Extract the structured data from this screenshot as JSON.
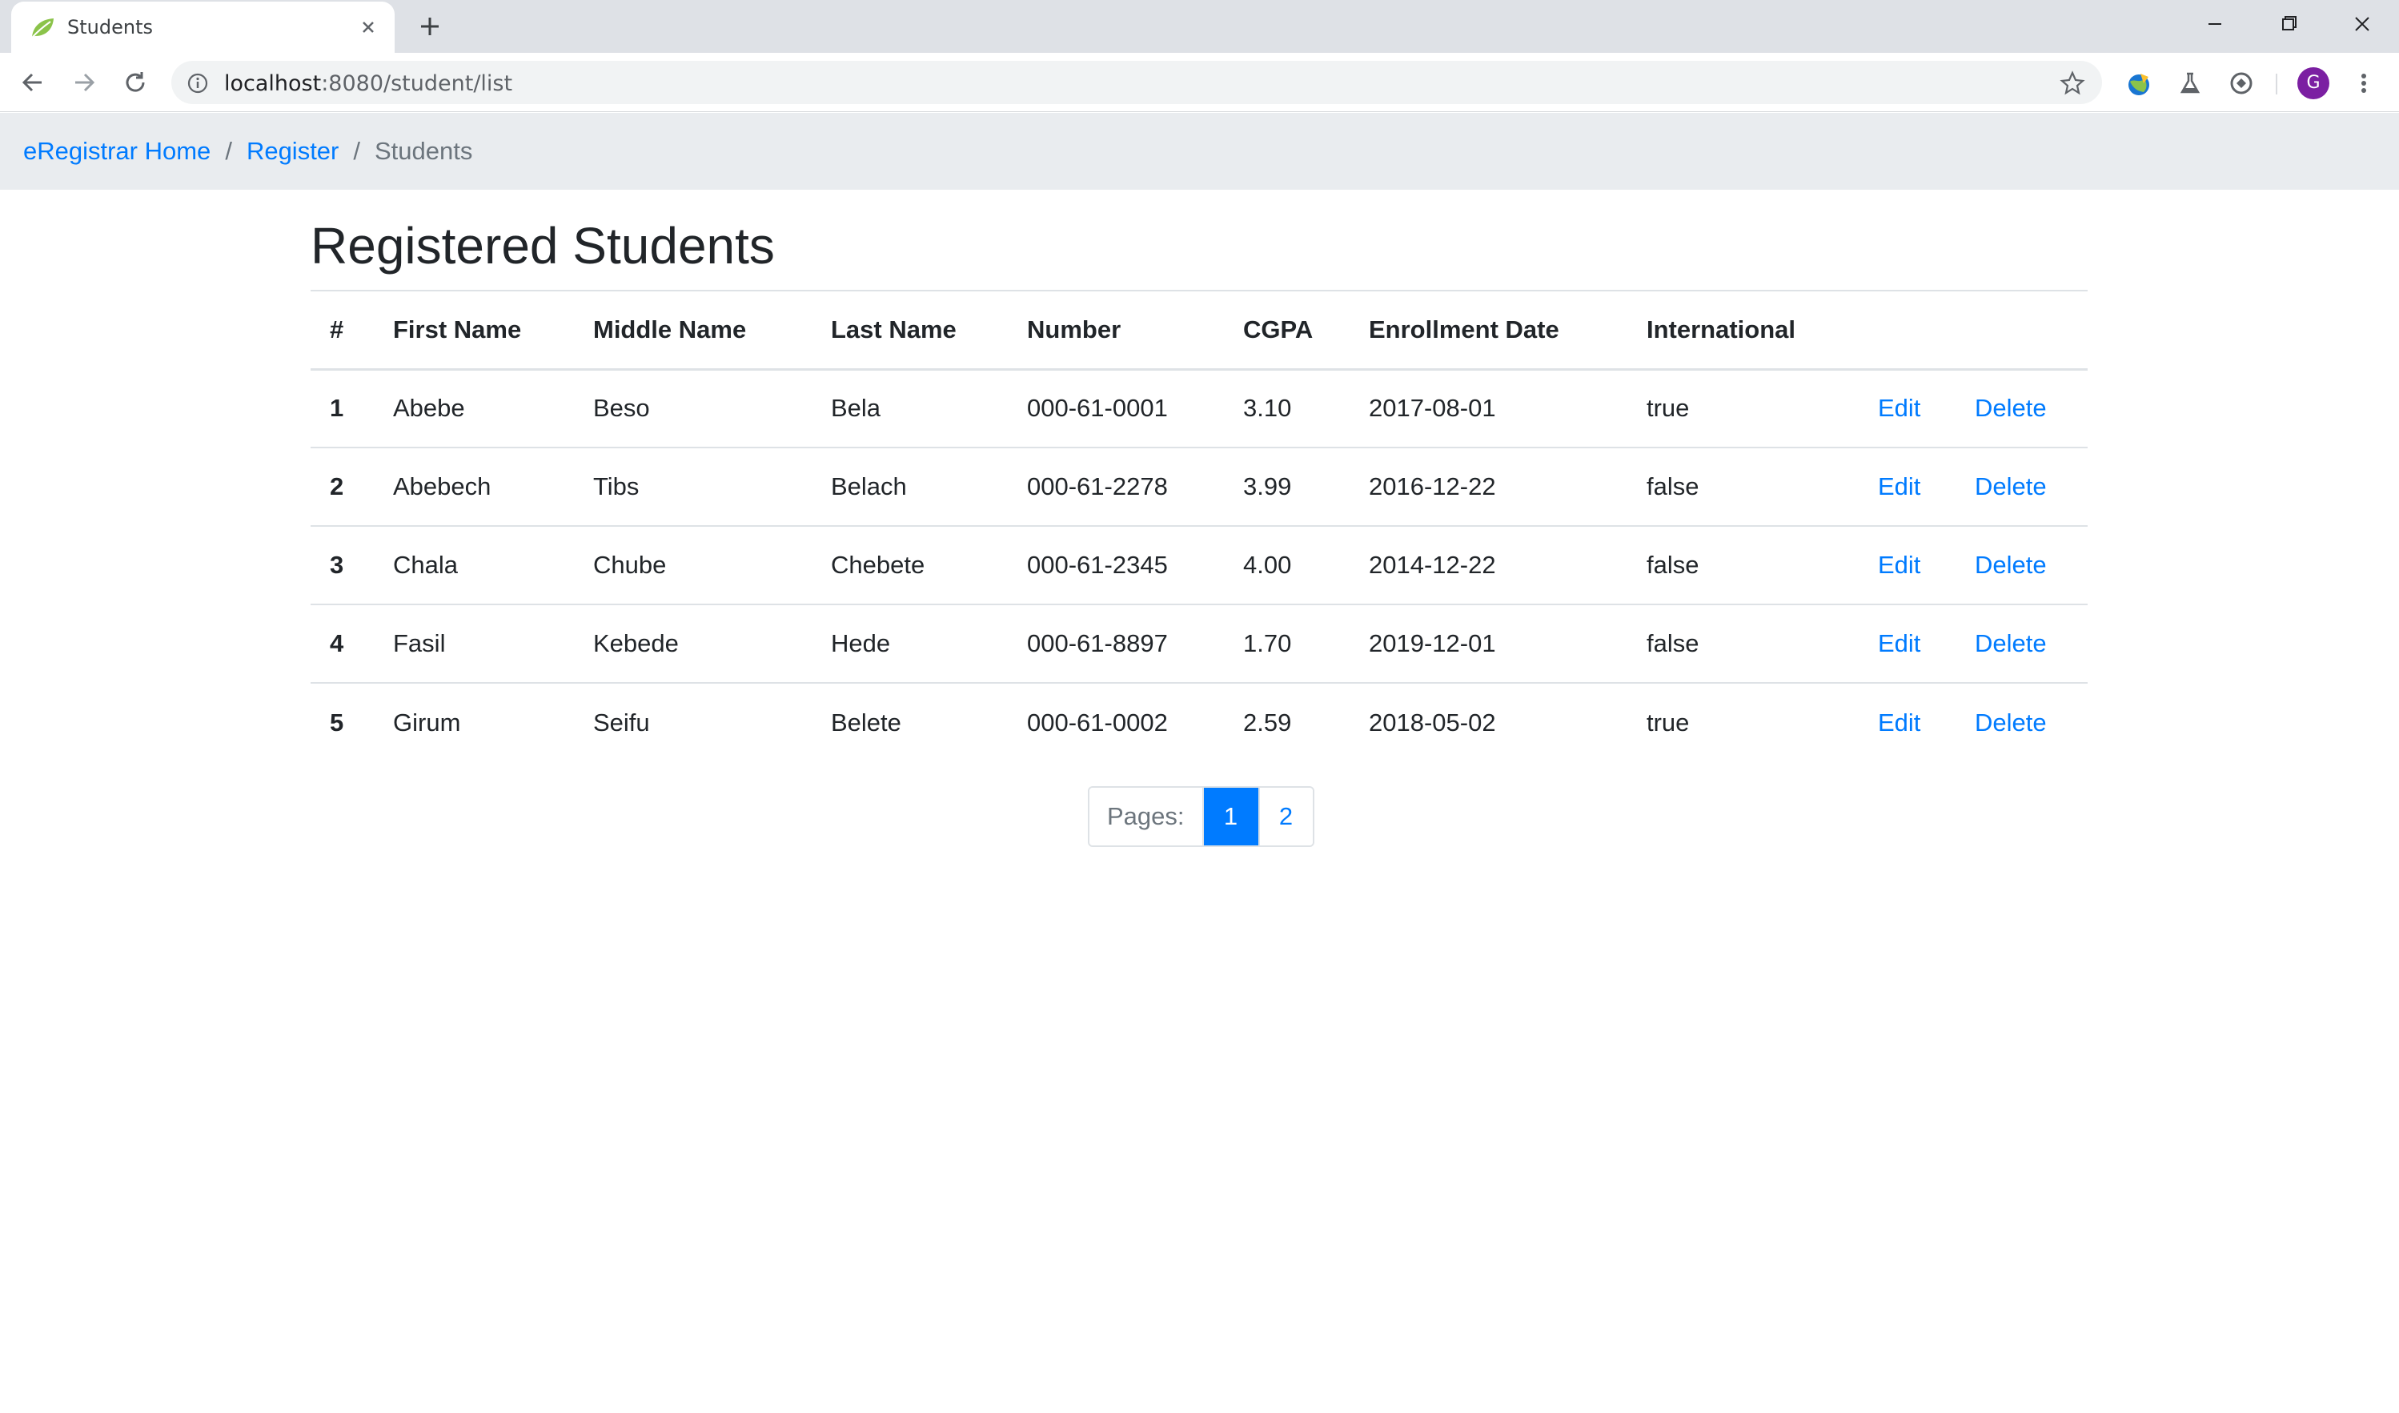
{
  "browser": {
    "tab_title": "Students",
    "url_host": "localhost",
    "url_rest": ":8080/student/list",
    "avatar_letter": "G",
    "icons": [
      "leaf-favicon-icon",
      "close-icon",
      "plus-icon",
      "back-icon",
      "forward-icon",
      "reload-icon",
      "info-icon",
      "star-icon",
      "minimize-icon",
      "restore-icon",
      "window-close-icon",
      "menu-dots-icon"
    ]
  },
  "breadcrumb": {
    "home": "eRegistrar Home",
    "register": "Register",
    "current": "Students",
    "separator": "/"
  },
  "page": {
    "title": "Registered Students"
  },
  "table": {
    "headers": {
      "index": "#",
      "first": "First Name",
      "middle": "Middle Name",
      "last": "Last Name",
      "number": "Number",
      "cgpa": "CGPA",
      "date": "Enrollment Date",
      "international": "International"
    },
    "rows": [
      {
        "idx": "1",
        "first": "Abebe",
        "middle": "Beso",
        "last": "Bela",
        "number": "000-61-0001",
        "cgpa": "3.10",
        "date": "2017-08-01",
        "intl": "true",
        "edit": "Edit",
        "delete": "Delete"
      },
      {
        "idx": "2",
        "first": "Abebech",
        "middle": "Tibs",
        "last": "Belach",
        "number": "000-61-2278",
        "cgpa": "3.99",
        "date": "2016-12-22",
        "intl": "false",
        "edit": "Edit",
        "delete": "Delete"
      },
      {
        "idx": "3",
        "first": "Chala",
        "middle": "Chube",
        "last": "Chebete",
        "number": "000-61-2345",
        "cgpa": "4.00",
        "date": "2014-12-22",
        "intl": "false",
        "edit": "Edit",
        "delete": "Delete"
      },
      {
        "idx": "4",
        "first": "Fasil",
        "middle": "Kebede",
        "last": "Hede",
        "number": "000-61-8897",
        "cgpa": "1.70",
        "date": "2019-12-01",
        "intl": "false",
        "edit": "Edit",
        "delete": "Delete"
      },
      {
        "idx": "5",
        "first": "Girum",
        "middle": "Seifu",
        "last": "Belete",
        "number": "000-61-0002",
        "cgpa": "2.59",
        "date": "2018-05-02",
        "intl": "true",
        "edit": "Edit",
        "delete": "Delete"
      }
    ]
  },
  "pagination": {
    "label": "Pages:",
    "pages": [
      "1",
      "2"
    ],
    "current": "1"
  },
  "colors": {
    "link": "#007bff",
    "breadcrumb_bg": "#e9ecef",
    "active_page_bg": "#007bff",
    "avatar": "#7b1fa2"
  }
}
